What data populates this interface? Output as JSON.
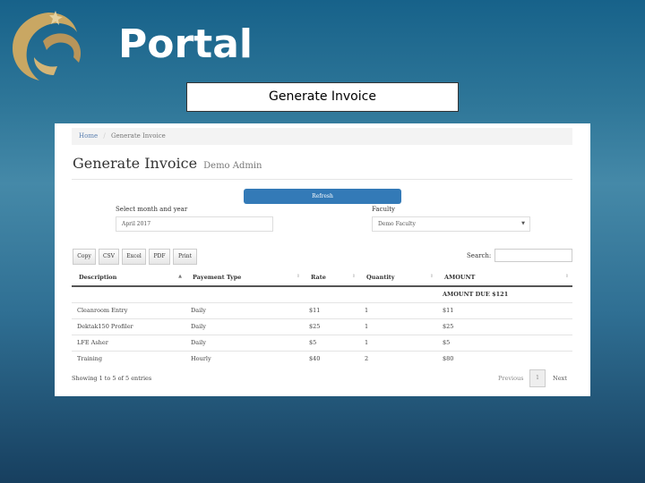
{
  "header": {
    "brand": "Portal",
    "slide_title": "Generate Invoice"
  },
  "breadcrumb": {
    "home": "Home",
    "sep": "/",
    "current": "Generate Invoice"
  },
  "page": {
    "title": "Generate Invoice",
    "subtitle": "Demo Admin"
  },
  "form": {
    "refresh": "Refresh",
    "month_label": "Select month and year",
    "month_value": "April 2017",
    "faculty_label": "Faculty",
    "faculty_value": "Demo Faculty"
  },
  "export_buttons": [
    "Copy",
    "CSV",
    "Excel",
    "PDF",
    "Print"
  ],
  "search": {
    "label": "Search:",
    "value": ""
  },
  "table": {
    "headers": [
      "Description",
      "Payement Type",
      "Rate",
      "Quantity",
      "AMOUNT"
    ],
    "amount_due": "AMOUNT DUE $121",
    "rows": [
      [
        "Cleanroom Entry",
        "Daily",
        "$11",
        "1",
        "$11"
      ],
      [
        "Dektak150 Profiler",
        "Daily",
        "$25",
        "1",
        "$25"
      ],
      [
        "LFE Asher",
        "Daily",
        "$5",
        "1",
        "$5"
      ],
      [
        "Training",
        "Hourly",
        "$40",
        "2",
        "$80"
      ]
    ]
  },
  "footer": {
    "info": "Showing 1 to 5 of 5 entries",
    "previous": "Previous",
    "page": "1",
    "next": "Next"
  }
}
